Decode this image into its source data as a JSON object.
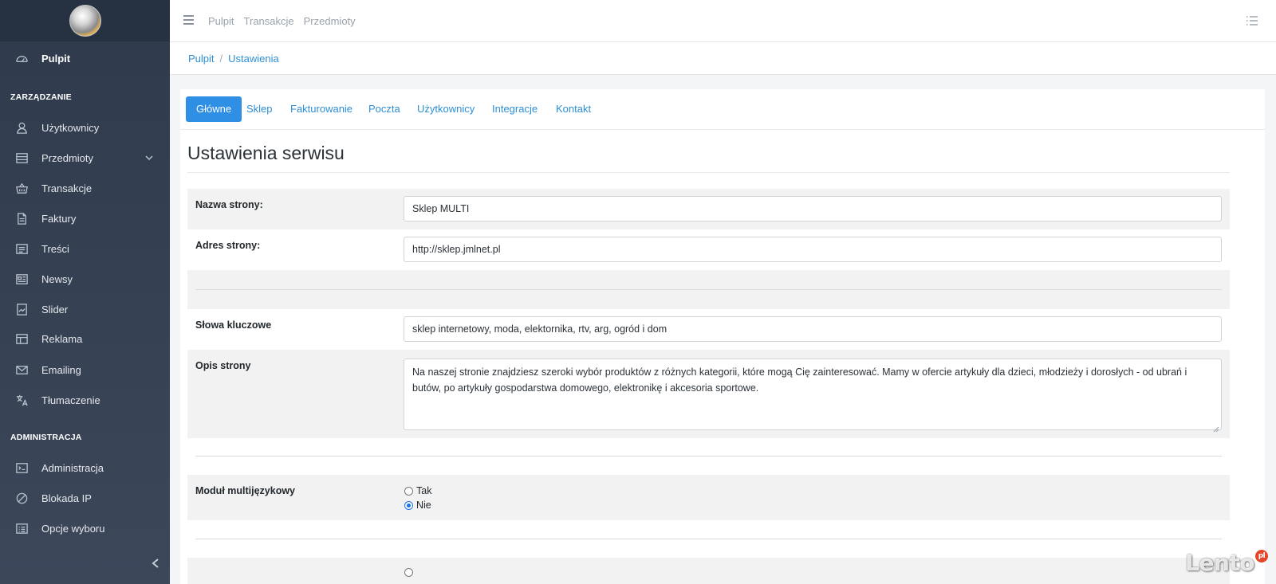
{
  "sidebar": {
    "items": [
      {
        "label": "Pulpit",
        "icon": "speedometer-icon"
      },
      {
        "label": "Użytkownicy",
        "icon": "user-icon"
      },
      {
        "label": "Przedmioty",
        "icon": "list-box-icon"
      },
      {
        "label": "Transakcje",
        "icon": "basket-icon"
      },
      {
        "label": "Faktury",
        "icon": "document-icon"
      },
      {
        "label": "Treści",
        "icon": "content-icon"
      },
      {
        "label": "Newsy",
        "icon": "newspaper-icon"
      },
      {
        "label": "Slider",
        "icon": "slider-icon"
      },
      {
        "label": "Reklama",
        "icon": "layout-icon"
      },
      {
        "label": "Emailing",
        "icon": "envelope-icon"
      },
      {
        "label": "Tłumaczenie",
        "icon": "translate-icon"
      },
      {
        "label": "Administracja",
        "icon": "terminal-icon"
      },
      {
        "label": "Blokada IP",
        "icon": "ban-icon"
      },
      {
        "label": "Opcje wyboru",
        "icon": "options-icon"
      }
    ],
    "sections": {
      "management": "ZARZĄDZANIE",
      "administration": "ADMINISTRACJA"
    }
  },
  "header": {
    "nav": [
      "Pulpit",
      "Transakcje",
      "Przedmioty"
    ]
  },
  "breadcrumb": {
    "home": "Pulpit",
    "separator": "/",
    "current": "Ustawienia"
  },
  "tabs": [
    "Główne",
    "Sklep",
    "Fakturowanie",
    "Poczta",
    "Użytkownicy",
    "Integracje",
    "Kontakt"
  ],
  "page": {
    "title": "Ustawienia serwisu"
  },
  "form": {
    "site_name": {
      "label": "Nazwa strony:",
      "value": "Sklep MULTI"
    },
    "site_address": {
      "label": "Adres strony:",
      "value": "http://sklep.jmlnet.pl"
    },
    "keywords": {
      "label": "Słowa kluczowe",
      "value": "sklep internetowy, moda, elektornika, rtv, arg, ogród i dom"
    },
    "description": {
      "label": "Opis strony",
      "value": "Na naszej stronie znajdziesz szeroki wybór produktów z różnych kategorii, które mogą Cię zainteresować. Mamy w ofercie artykuły dla dzieci, młodzieży i dorosłych - od ubrań i butów, po artykuły gospodarstwa domowego, elektronikę i akcesoria sportowe."
    },
    "multilang": {
      "label": "Moduł multijęzykowy",
      "option_yes": "Tak",
      "option_no": "Nie",
      "selected": "Nie"
    }
  },
  "watermark": {
    "text": "Lento",
    "suffix": "pl"
  }
}
